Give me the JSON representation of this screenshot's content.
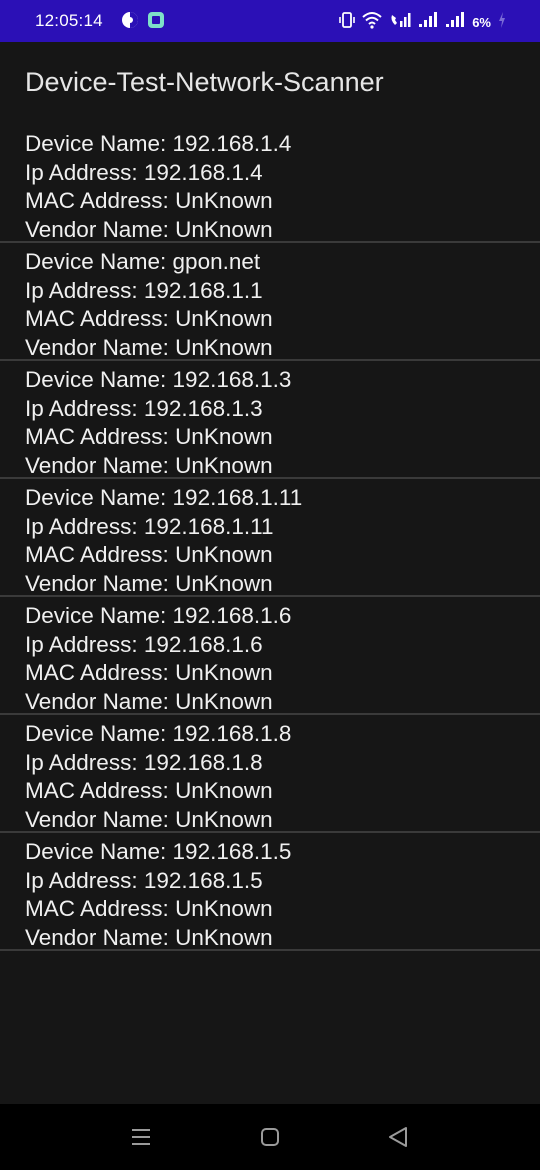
{
  "status_bar": {
    "time": "12:05:14",
    "battery": "6%"
  },
  "app": {
    "title": "Device-Test-Network-Scanner"
  },
  "labels": {
    "device_name": "Device Name: ",
    "ip_address": "Ip Address: ",
    "mac_address": "MAC Address: ",
    "vendor_name": "Vendor Name: "
  },
  "devices": [
    {
      "name": "192.168.1.4",
      "ip": "192.168.1.4",
      "mac": "UnKnown",
      "vendor": "UnKnown"
    },
    {
      "name": "gpon.net",
      "ip": "192.168.1.1",
      "mac": "UnKnown",
      "vendor": "UnKnown"
    },
    {
      "name": "192.168.1.3",
      "ip": "192.168.1.3",
      "mac": "UnKnown",
      "vendor": "UnKnown"
    },
    {
      "name": "192.168.1.11",
      "ip": "192.168.1.11",
      "mac": "UnKnown",
      "vendor": "UnKnown"
    },
    {
      "name": "192.168.1.6",
      "ip": "192.168.1.6",
      "mac": "UnKnown",
      "vendor": "UnKnown"
    },
    {
      "name": "192.168.1.8",
      "ip": "192.168.1.8",
      "mac": "UnKnown",
      "vendor": "UnKnown"
    },
    {
      "name": "192.168.1.5",
      "ip": "192.168.1.5",
      "mac": "UnKnown",
      "vendor": "UnKnown"
    }
  ],
  "icons": {
    "status_left": [
      "notification-circle-icon",
      "app-notification-icon"
    ],
    "status_right": [
      "vibrate-icon",
      "wifi-icon",
      "volte-signal-icon",
      "signal-bars-icon",
      "signal-bars-icon",
      "battery-icon"
    ],
    "nav": [
      "recents-icon",
      "home-icon",
      "back-icon"
    ]
  },
  "colors": {
    "status_bar": "#2b10b6",
    "background": "#161616",
    "divider": "#3a3a3a",
    "navbar": "#000000"
  }
}
